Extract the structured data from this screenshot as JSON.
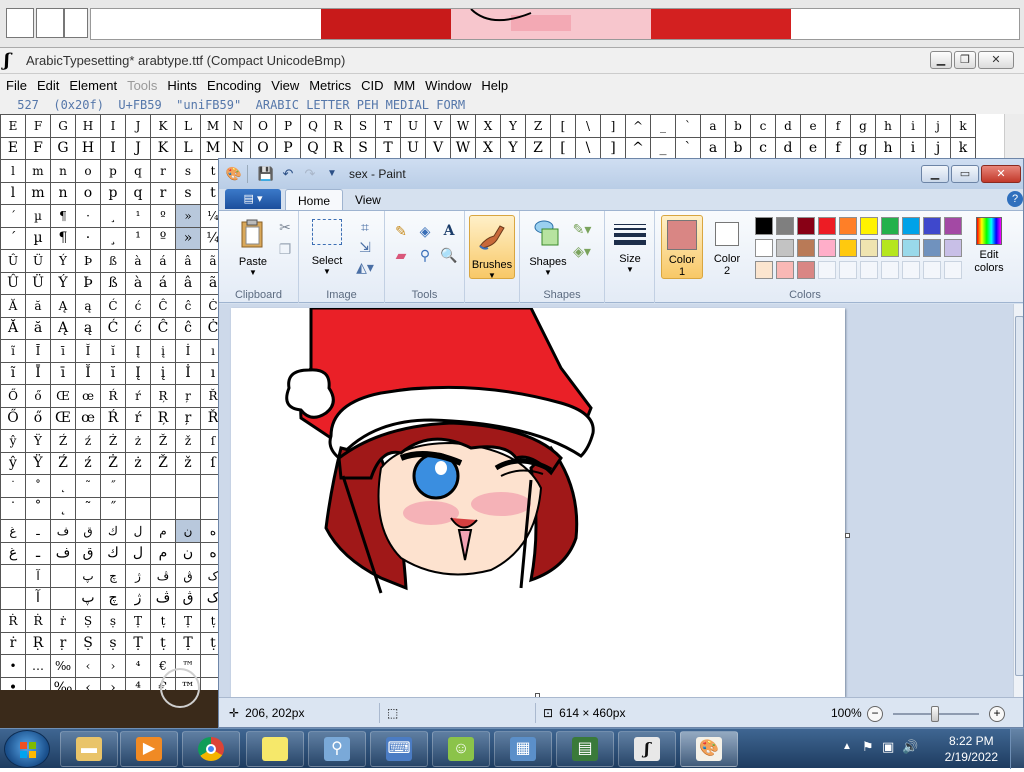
{
  "fontforge": {
    "window_title": "ArabicTypesetting*  arabtype.ttf (Compact UnicodeBmp)",
    "menu": [
      "File",
      "Edit",
      "Element",
      "Tools",
      "Hints",
      "Encoding",
      "View",
      "Metrics",
      "CID",
      "MM",
      "Window",
      "Help"
    ],
    "disabled_menu": "Tools",
    "info": " 527  (0x20f)  U+FB59  \"uniFB59\"  ARABIC LETTER PEH MEDIAL FORM",
    "glyph_rows": [
      [
        "E",
        "F",
        "G",
        "H",
        "I",
        "J",
        "K",
        "L",
        "M",
        "N",
        "O",
        "P",
        "Q",
        "R",
        "S",
        "T",
        "U",
        "V",
        "W",
        "X",
        "Y",
        "Z",
        "[",
        "\\",
        "]",
        "^",
        "_",
        "`",
        "a",
        "b",
        "c",
        "d",
        "e",
        "f",
        "g",
        "h",
        "i",
        "j",
        "k"
      ],
      [
        "E",
        "F",
        "G",
        "H",
        "I",
        "J",
        "K",
        "L",
        "M",
        "N",
        "O",
        "P",
        "Q",
        "R",
        "S",
        "T",
        "U",
        "V",
        "W",
        "X",
        "Y",
        "Z",
        "[",
        "\\",
        "]",
        "^",
        "_",
        "`",
        "a",
        "b",
        "c",
        "d",
        "e",
        "f",
        "g",
        "h",
        "i",
        "j",
        "k"
      ],
      [
        "l",
        "m",
        "n",
        "o",
        "p",
        "q",
        "r",
        "s",
        "t"
      ],
      [
        "l",
        "m",
        "n",
        "o",
        "p",
        "q",
        "r",
        "s",
        "t"
      ],
      [
        "´",
        "µ",
        "¶",
        "·",
        "¸",
        "¹",
        "º",
        "»",
        "¼"
      ],
      [
        "´",
        "µ",
        "¶",
        "·",
        "¸",
        "¹",
        "º",
        "»",
        "¼"
      ],
      [
        "Û",
        "Ü",
        "Ý",
        "Þ",
        "ß",
        "à",
        "á",
        "â",
        "ã"
      ],
      [
        "Û",
        "Ü",
        "Ý",
        "Þ",
        "ß",
        "à",
        "á",
        "â",
        "ã"
      ],
      [
        "Ă",
        "ă",
        "Ą",
        "ą",
        "Ć",
        "ć",
        "Ĉ",
        "ĉ",
        "Ċ"
      ],
      [
        "Ă",
        "ă",
        "Ą",
        "ą",
        "Ć",
        "ć",
        "Ĉ",
        "ĉ",
        "Ċ"
      ],
      [
        "ĩ",
        "Ī",
        "ī",
        "Ĭ",
        "ĭ",
        "Į",
        "į",
        "İ",
        "ı"
      ],
      [
        "ĩ",
        "Ī",
        "ī",
        "Ĭ",
        "ĭ",
        "Į",
        "į",
        "İ",
        "ı"
      ],
      [
        "Ő",
        "ő",
        "Œ",
        "œ",
        "Ŕ",
        "ŕ",
        "Ŗ",
        "ŗ",
        "Ř"
      ],
      [
        "Ő",
        "ő",
        "Œ",
        "œ",
        "Ŕ",
        "ŕ",
        "Ŗ",
        "ŗ",
        "Ř"
      ],
      [
        "ŷ",
        "Ÿ",
        "Ź",
        "ź",
        "Ż",
        "ż",
        "Ž",
        "ž",
        "ſ"
      ],
      [
        "ŷ",
        "Ÿ",
        "Ź",
        "ź",
        "Ż",
        "ż",
        "Ž",
        "ž",
        "ſ"
      ],
      [
        "˙",
        "˚",
        "˛",
        "˜",
        "˝",
        "",
        "",
        "",
        ""
      ],
      [
        "˙",
        "˚",
        "˛",
        "˜",
        "˝",
        "",
        "",
        "",
        ""
      ],
      [
        "غ",
        "ـ",
        "ف",
        "ق",
        "ك",
        "ل",
        "م",
        "ن",
        "ه"
      ],
      [
        "غ",
        "ـ",
        "ف",
        "ق",
        "ك",
        "ل",
        "م",
        "ن",
        "ه"
      ],
      [
        "",
        "آ",
        "",
        "پ",
        "چ",
        "ژ",
        "ڤ",
        "ڨ",
        "ک"
      ],
      [
        "",
        "آ",
        "",
        "پ",
        "چ",
        "ژ",
        "ڤ",
        "ڨ",
        "ک"
      ],
      [
        "Ṙ",
        "Ṙ",
        "ṙ",
        "Ṣ",
        "ṣ",
        "Ṭ",
        "ṭ",
        "Ṭ",
        "ṭ"
      ],
      [
        "ṙ",
        "Ṛ",
        "ṛ",
        "Ṣ",
        "ṣ",
        "Ṭ",
        "ṭ",
        "Ṭ",
        "ṭ"
      ],
      [
        "•",
        "…",
        "‰",
        "‹",
        "›",
        "⁴",
        "€",
        "™",
        ""
      ],
      [
        "•",
        "…",
        "‰",
        "‹",
        "›",
        "⁴",
        "€",
        "™",
        ""
      ]
    ]
  },
  "paint": {
    "title": "sex - Paint",
    "tabs": [
      "Home",
      "View"
    ],
    "groups": {
      "clipboard": {
        "label": "Clipboard",
        "paste": "Paste"
      },
      "image": {
        "label": "Image",
        "select": "Select"
      },
      "tools": {
        "label": "Tools"
      },
      "brushes": {
        "label": "Brushes"
      },
      "shapes": {
        "label": "Shapes",
        "button": "Shapes"
      },
      "size": {
        "label": "Size"
      },
      "colors": {
        "label": "Colors",
        "color1": "Color",
        "color1_num": "1",
        "color2": "Color",
        "color2_num": "2",
        "edit": "Edit colors"
      }
    },
    "color1_value": "#d98684",
    "color2_value": "#ffffff",
    "palette_row1": [
      "#000000",
      "#7f7f7f",
      "#880015",
      "#ed1c24",
      "#ff7f27",
      "#fff200",
      "#22b14c",
      "#00a2e8",
      "#3f48cc",
      "#a349a4"
    ],
    "palette_row2": [
      "#ffffff",
      "#c3c3c3",
      "#b97a57",
      "#ffaec9",
      "#ffc90e",
      "#efe4b0",
      "#b5e61d",
      "#99d9ea",
      "#7092be",
      "#c8bfe7"
    ],
    "palette_row3": [
      "#fbe5cf",
      "#f9b8b5",
      "#d98684",
      "",
      "",
      "",
      "",
      "",
      "",
      ""
    ],
    "status": {
      "cursor_pos": "206, 202px",
      "canvas_size": "614 × 460px",
      "zoom": "100%"
    }
  },
  "taskbar": {
    "time": "8:22 PM",
    "date": "2/19/2022",
    "apps": [
      "explorer",
      "media-player",
      "chrome",
      "sticky-notes",
      "magnifier",
      "remote-desktop",
      "messenger",
      "photo-viewer",
      "task-manager",
      "fontforge",
      "paint"
    ]
  }
}
